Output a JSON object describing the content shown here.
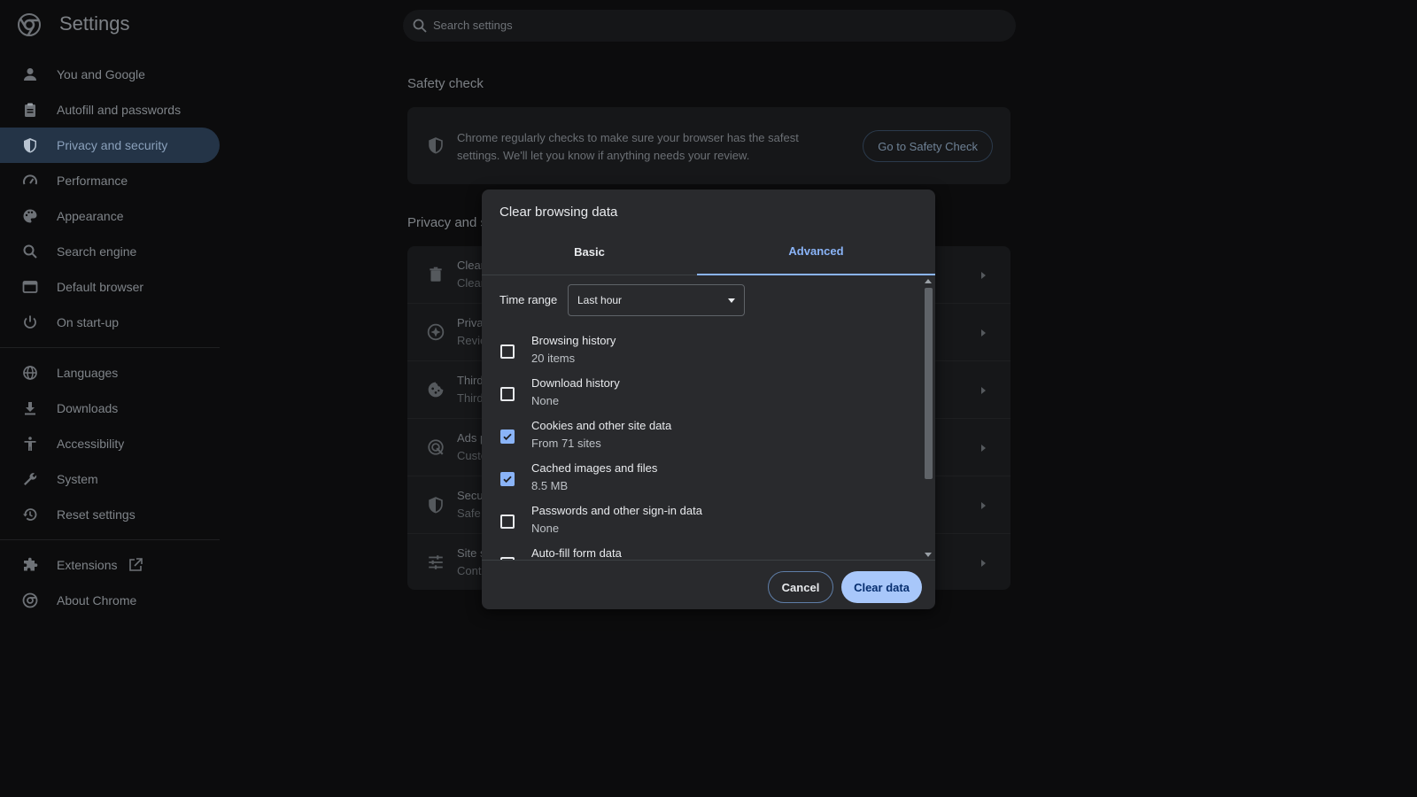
{
  "app": {
    "title": "Settings"
  },
  "search": {
    "placeholder": "Search settings"
  },
  "sidebar": {
    "items": [
      {
        "label": "You and Google",
        "icon": "person-icon"
      },
      {
        "label": "Autofill and passwords",
        "icon": "clipboard-icon"
      },
      {
        "label": "Privacy and security",
        "icon": "shield-icon",
        "active": true
      },
      {
        "label": "Performance",
        "icon": "gauge-icon"
      },
      {
        "label": "Appearance",
        "icon": "palette-icon"
      },
      {
        "label": "Search engine",
        "icon": "search-icon"
      },
      {
        "label": "Default browser",
        "icon": "browser-icon"
      },
      {
        "label": "On start-up",
        "icon": "power-icon"
      }
    ],
    "items2": [
      {
        "label": "Languages",
        "icon": "globe-icon"
      },
      {
        "label": "Downloads",
        "icon": "download-icon"
      },
      {
        "label": "Accessibility",
        "icon": "accessibility-icon"
      },
      {
        "label": "System",
        "icon": "wrench-icon"
      },
      {
        "label": "Reset settings",
        "icon": "history-icon"
      }
    ],
    "items3": [
      {
        "label": "Extensions",
        "icon": "puzzle-icon"
      },
      {
        "label": "About Chrome",
        "icon": "chrome-icon"
      }
    ]
  },
  "main": {
    "safety_check_title": "Safety check",
    "safety_check_text": "Chrome regularly checks to make sure your browser has the safest settings. We'll let you know if anything needs your review.",
    "safety_check_button": "Go to Safety Check",
    "privacy_title": "Privacy and s",
    "privacy_rows": [
      {
        "title": "Clear",
        "sub": "Clear",
        "icon": "trash-icon"
      },
      {
        "title": "Priva",
        "sub": "Revie",
        "icon": "compass-icon"
      },
      {
        "title": "Third",
        "sub": "Third",
        "icon": "cookie-icon"
      },
      {
        "title": "Ads p",
        "sub": "Custo",
        "icon": "ads-icon"
      },
      {
        "title": "Secu",
        "sub": "Safe",
        "icon": "shield-icon"
      },
      {
        "title": "Site s",
        "sub": "Cont",
        "icon": "sliders-icon"
      }
    ]
  },
  "dialog": {
    "title": "Clear browsing data",
    "tabs": {
      "basic": "Basic",
      "advanced": "Advanced"
    },
    "active_tab": "Advanced",
    "time_range_label": "Time range",
    "time_range_value": "Last hour",
    "items": [
      {
        "title": "Browsing history",
        "sub": "20 items",
        "checked": false
      },
      {
        "title": "Download history",
        "sub": "None",
        "checked": false
      },
      {
        "title": "Cookies and other site data",
        "sub": "From 71 sites",
        "checked": true
      },
      {
        "title": "Cached images and files",
        "sub": "8.5 MB",
        "checked": true
      },
      {
        "title": "Passwords and other sign-in data",
        "sub": "None",
        "checked": false
      },
      {
        "title": "Auto-fill form data",
        "sub": "",
        "checked": false
      }
    ],
    "cancel": "Cancel",
    "confirm": "Clear data"
  },
  "colors": {
    "accent": "#8ab4f8",
    "primary_button": "#a8c7fa",
    "dialog_bg": "#292a2d",
    "page_bg": "#0c0c0d",
    "active_nav_bg": "#243447"
  }
}
